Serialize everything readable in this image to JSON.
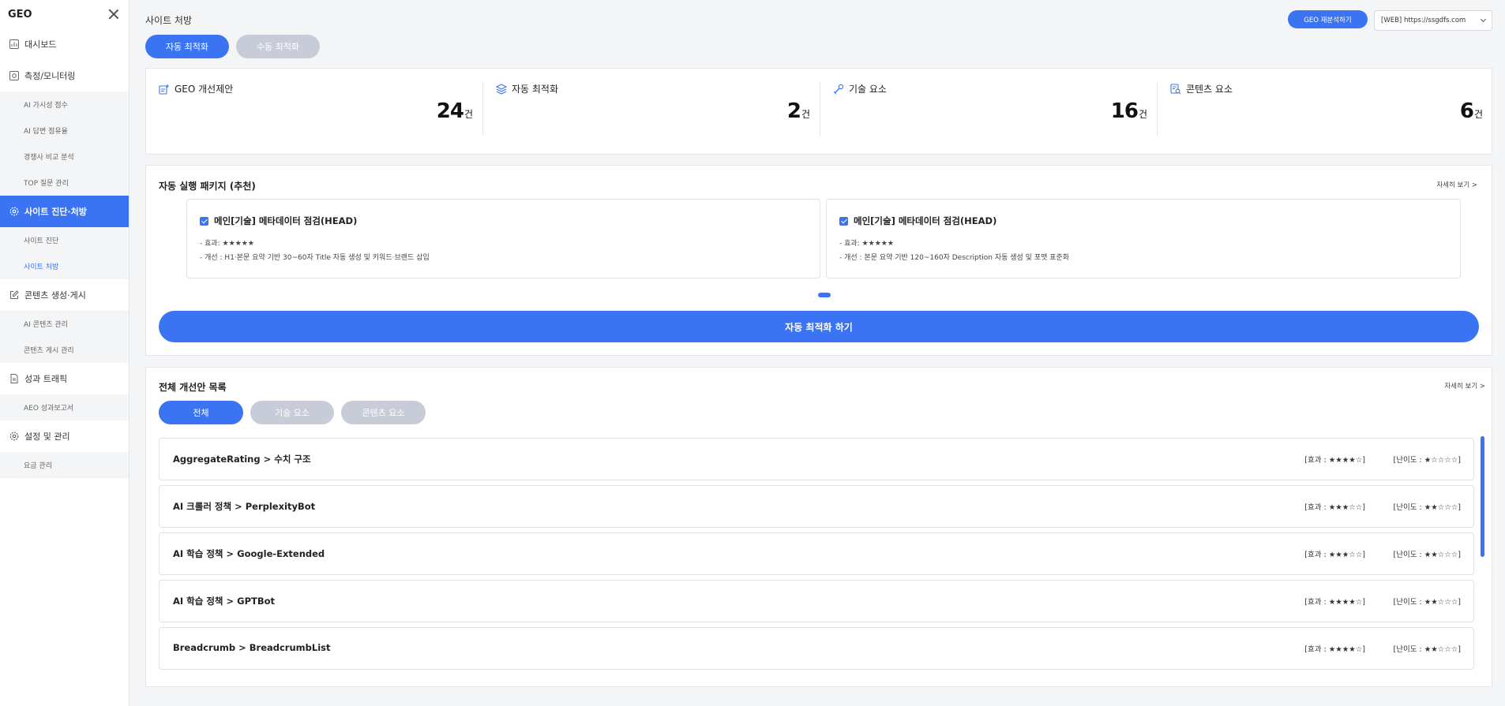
{
  "sidebar": {
    "logo": "GEO",
    "items": [
      {
        "label": "대시보드",
        "icon": "chart-icon"
      },
      {
        "label": "측정/모니터링",
        "icon": "monitor-icon",
        "sub": [
          "AI 가시성 점수",
          "AI 답변 점유율",
          "경쟁사 비교 분석",
          "TOP 질문 관리"
        ]
      },
      {
        "label": "사이트 진단·처방",
        "icon": "gear-badge-icon",
        "active": true,
        "sub": [
          "사이트 진단",
          "사이트 처방"
        ],
        "active_sub": 1
      },
      {
        "label": "콘텐츠 생성·게시",
        "icon": "edit-icon",
        "sub": [
          "AI 콘텐츠 관리",
          "콘텐츠 게시 관리"
        ]
      },
      {
        "label": "성과 트래픽",
        "icon": "document-icon",
        "sub": [
          "AEO 성과보고서"
        ]
      },
      {
        "label": "설정 및 관리",
        "icon": "gear-icon",
        "sub": [
          "요금 관리"
        ]
      }
    ]
  },
  "header": {
    "title": "사이트 처방",
    "tabs": [
      "자동 최적화",
      "수동 최적화"
    ],
    "reanalyze_label": "GEO 재분석하기",
    "site_select": "[WEB] https://ssgdfs.com"
  },
  "stats": [
    {
      "label": "GEO 개선제안",
      "value": "24",
      "unit": "건",
      "icon": "suggest-icon"
    },
    {
      "label": "자동 최적화",
      "value": "2",
      "unit": "건",
      "icon": "layers-icon"
    },
    {
      "label": "기술 요소",
      "value": "16",
      "unit": "건",
      "icon": "tool-icon"
    },
    {
      "label": "콘텐츠 요소",
      "value": "6",
      "unit": "건",
      "icon": "content-icon"
    }
  ],
  "package": {
    "title": "자동 실행 패키지 (추천)",
    "more": "자세히 보기 >",
    "cards": [
      {
        "title": "메인[기술] 메타데이터 점검(HEAD)",
        "effect": "- 효과: ★★★★★",
        "desc": "- 개선 : H1·본문 요약 기반 30~60자 Title 자동 생성 및 키워드·브랜드 삽입"
      },
      {
        "title": "메인[기술] 메타데이터 점검(HEAD)",
        "effect": "- 효과: ★★★★★",
        "desc": "- 개선 : 본문 요약 기반 120~160자 Description 자동 생성 및 포맷 표준화"
      }
    ],
    "run_label": "자동 최적화 하기"
  },
  "list": {
    "title": "전체 개선안 목록",
    "more": "자세히 보기 >",
    "filters": [
      "전체",
      "기술 요소",
      "콘텐츠 요소"
    ],
    "rows": [
      {
        "title": "AggregateRating > 수치 구조",
        "effect": "[효과 : ★★★★☆]",
        "difficulty": "[난이도 : ★☆☆☆☆]"
      },
      {
        "title": "AI 크롤러 정책 > PerplexityBot",
        "effect": "[효과 : ★★★☆☆]",
        "difficulty": "[난이도 : ★★☆☆☆]"
      },
      {
        "title": "AI 학습 정책 > Google-Extended",
        "effect": "[효과 : ★★★☆☆]",
        "difficulty": "[난이도 : ★★☆☆☆]"
      },
      {
        "title": "AI 학습 정책 > GPTBot",
        "effect": "[효과 : ★★★★☆]",
        "difficulty": "[난이도 : ★★☆☆☆]"
      },
      {
        "title": "Breadcrumb > BreadcrumbList",
        "effect": "[효과 : ★★★★☆]",
        "difficulty": "[난이도 : ★★☆☆☆]"
      }
    ]
  },
  "colors": {
    "accent": "#3b74f2",
    "inactive": "#c7ccd8"
  }
}
